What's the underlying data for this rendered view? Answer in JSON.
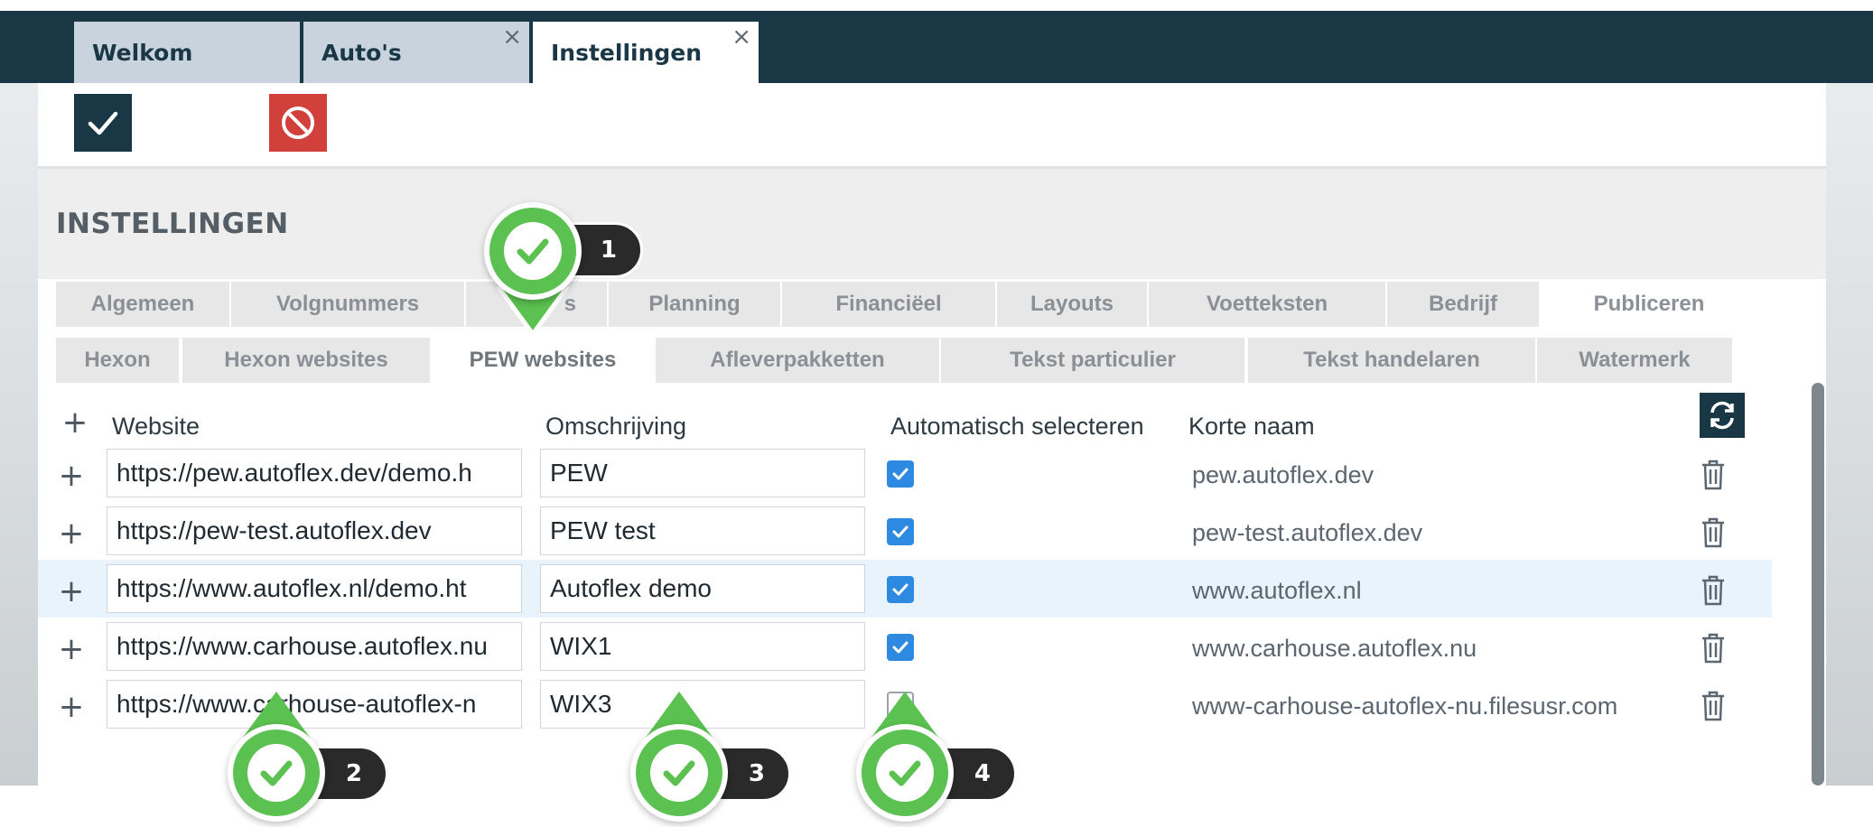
{
  "window_tabs": [
    {
      "label": "Welkom",
      "closable": false
    },
    {
      "label": "Auto's",
      "closable": true
    },
    {
      "label": "Instellingen",
      "closable": true,
      "active": true
    }
  ],
  "close_glyph": "×",
  "toolbar": {
    "save_icon": "checkmark-icon",
    "cancel_icon": "block-icon",
    "save_color": "#1a3746",
    "cancel_color": "#d1403a"
  },
  "settings": {
    "title": "INSTELLINGEN",
    "tabs_row1": [
      "Algemeen",
      "Volgnummers",
      "Opties",
      "Planning",
      "Financiëel",
      "Layouts",
      "Voetteksten",
      "Bedrijf",
      "Publiceren"
    ],
    "tabs_row2": [
      "Hexon",
      "Hexon websites",
      "PEW websites",
      "Afleverpakketten",
      "Tekst particulier",
      "Tekst handelaren",
      "Watermerk"
    ],
    "tab_row1_visible_partial": "s",
    "active_tab": "PEW websites"
  },
  "table": {
    "add_glyph": "+",
    "columns": {
      "website": "Website",
      "omschrijving": "Omschrijving",
      "auto": "Automatisch selecteren",
      "korte_naam": "Korte naam"
    },
    "rows": [
      {
        "website": "https://pew.autoflex.dev/demo.h",
        "omschrijving": "PEW",
        "auto": true,
        "korte_naam": "pew.autoflex.dev"
      },
      {
        "website": "https://pew-test.autoflex.dev",
        "omschrijving": "PEW test",
        "auto": true,
        "korte_naam": "pew-test.autoflex.dev"
      },
      {
        "website": "https://www.autoflex.nl/demo.ht",
        "omschrijving": "Autoflex demo",
        "auto": true,
        "korte_naam": "www.autoflex.nl",
        "highlighted": true
      },
      {
        "website": "https://www.carhouse.autoflex.nu",
        "omschrijving": "WIX1",
        "auto": true,
        "korte_naam": "www.carhouse.autoflex.nu"
      },
      {
        "website": "https://www.carhouse-autoflex-n",
        "omschrijving": "WIX3",
        "auto": false,
        "korte_naam": "www-carhouse-autoflex-nu.filesusr.com"
      }
    ]
  },
  "markers": [
    {
      "number": "1"
    },
    {
      "number": "2"
    },
    {
      "number": "3"
    },
    {
      "number": "4"
    }
  ],
  "colors": {
    "header_dark": "#1a3746",
    "checkbox_blue": "#2d8ae0",
    "marker_green": "#5bc150",
    "row_highlight": "#e8f3fb"
  }
}
